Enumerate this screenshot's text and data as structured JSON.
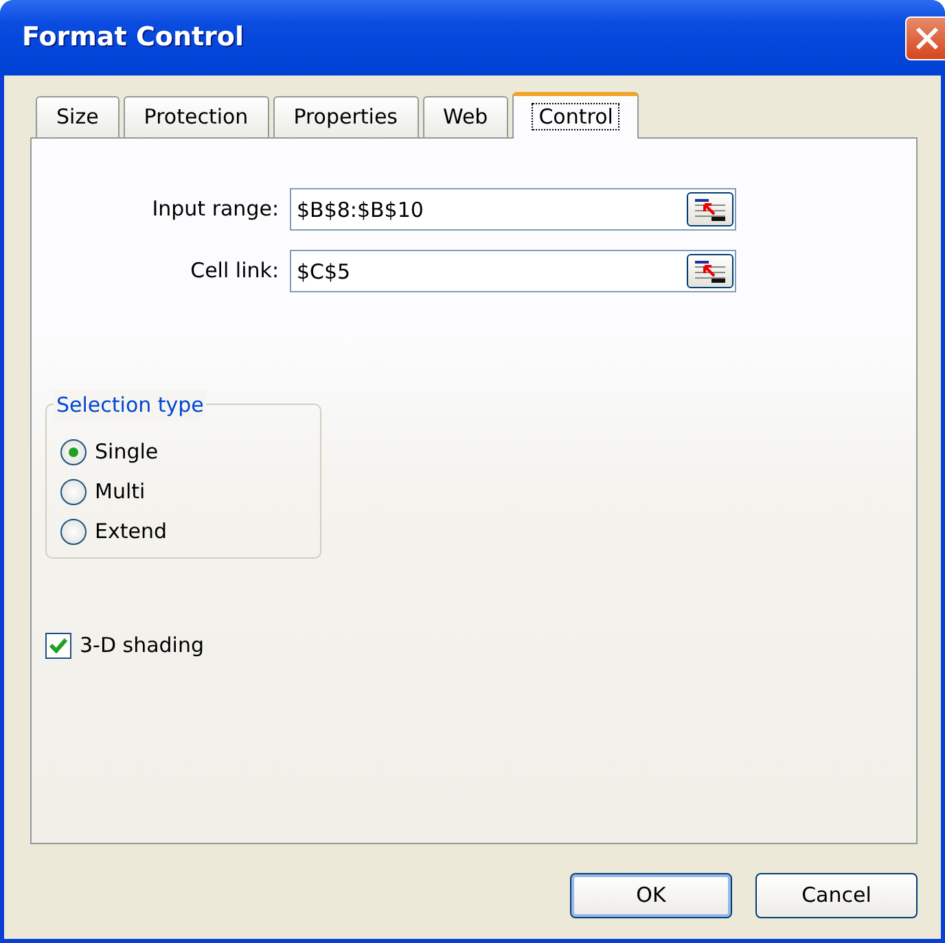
{
  "window": {
    "title": "Format Control"
  },
  "tabs": [
    {
      "label": "Size",
      "selected": false
    },
    {
      "label": "Protection",
      "selected": false
    },
    {
      "label": "Properties",
      "selected": false
    },
    {
      "label": "Web",
      "selected": false
    },
    {
      "label": "Control",
      "selected": true
    }
  ],
  "fields": [
    {
      "label": "Input range:",
      "value": "$B$8:$B$10"
    },
    {
      "label": "Cell link:",
      "value": "$C$5"
    }
  ],
  "selection_type": {
    "title": "Selection type",
    "options": [
      {
        "label": "Single",
        "selected": true
      },
      {
        "label": "Multi",
        "selected": false
      },
      {
        "label": "Extend",
        "selected": false
      }
    ]
  },
  "shading": {
    "label": "3-D shading",
    "checked": true
  },
  "buttons": [
    "OK",
    "Cancel"
  ]
}
